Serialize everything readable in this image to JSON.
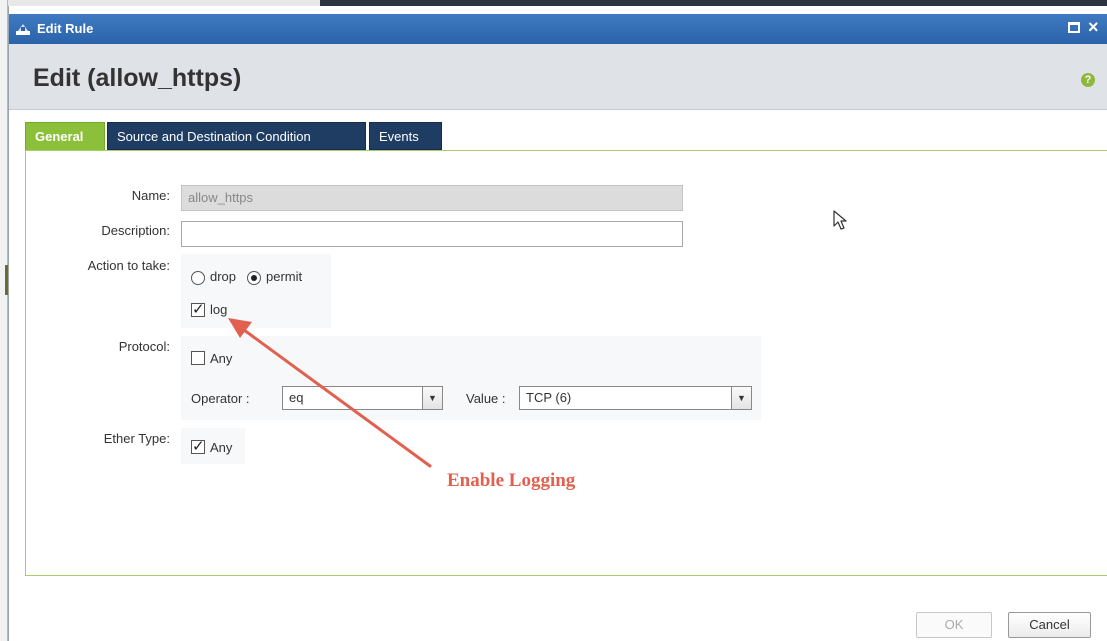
{
  "window": {
    "title": "Edit Rule",
    "heading": "Edit (allow_https)",
    "help_icon": "?",
    "close_glyph": "×"
  },
  "tabs": [
    {
      "label": "General",
      "active": true
    },
    {
      "label": "Source and Destination Condition",
      "active": false
    },
    {
      "label": "Events",
      "active": false
    }
  ],
  "form": {
    "name": {
      "label": "Name:",
      "value": "allow_https",
      "disabled": true
    },
    "description": {
      "label": "Description:",
      "value": ""
    },
    "action": {
      "label": "Action to take:",
      "options": [
        {
          "label": "drop",
          "selected": false
        },
        {
          "label": "permit",
          "selected": true
        }
      ],
      "log": {
        "label": "log",
        "checked": true
      }
    },
    "protocol": {
      "label": "Protocol:",
      "any": {
        "label": "Any",
        "checked": false
      },
      "operator": {
        "label": "Operator :",
        "value": "eq"
      },
      "value": {
        "label": "Value :",
        "value": "TCP (6)"
      }
    },
    "ether_type": {
      "label": "Ether Type:",
      "any": {
        "label": "Any",
        "checked": true
      }
    }
  },
  "annotation": {
    "text": "Enable Logging",
    "color": "#e2604f"
  },
  "buttons": {
    "ok": "OK",
    "cancel": "Cancel"
  },
  "colors": {
    "titlebar": "#2f6db5",
    "active_tab": "#8cbf3a",
    "inactive_tab": "#1f3d63",
    "panel_border": "#a8cc6a"
  }
}
